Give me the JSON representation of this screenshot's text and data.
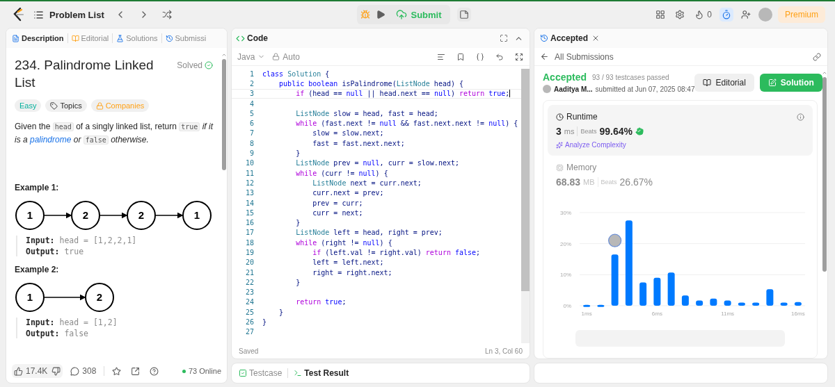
{
  "top_bar": {
    "title": "Problem List",
    "submit": "Submit",
    "streak": "0",
    "timer_active": true,
    "premium": "Premium"
  },
  "description_panel": {
    "tabs": [
      {
        "label": "Description",
        "kind": "description",
        "selected": true
      },
      {
        "label": "Editorial",
        "kind": "editorial",
        "selected": false
      },
      {
        "label": "Solutions",
        "kind": "solutions",
        "selected": false
      },
      {
        "label": "Submissi",
        "kind": "submissions",
        "selected": false
      }
    ],
    "title": "234. Palindrome Linked List",
    "status": "Solved",
    "tags": [
      {
        "label": "Easy",
        "kind": "difficulty"
      },
      {
        "label": "Topics",
        "kind": "topics"
      },
      {
        "label": "Companies",
        "kind": "companies"
      }
    ],
    "statement": [
      {
        "kind": "text",
        "text": "Given the "
      },
      {
        "kind": "code",
        "text": "head"
      },
      {
        "kind": "text",
        "text": " of a singly linked list, return "
      },
      {
        "kind": "code",
        "text": "true"
      },
      {
        "kind": "em",
        "text": " if it is a "
      },
      {
        "kind": "link",
        "text": "palindrome"
      },
      {
        "kind": "em",
        "text": " or "
      },
      {
        "kind": "code",
        "text": "false"
      },
      {
        "kind": "em",
        "text": " otherwise."
      }
    ],
    "examples": [
      {
        "heading": "Example 1:",
        "nodes": [
          "1",
          "2",
          "2",
          "1"
        ],
        "lines": [
          "**Input:** head = [1,2,2,1]",
          "**Output:** true"
        ]
      },
      {
        "heading": "Example 2:",
        "nodes": [
          "1",
          "2"
        ],
        "lines": [
          "**Input:** head = [1,2]",
          "**Output:** false"
        ]
      }
    ],
    "footer": {
      "likes": "17.4K",
      "comments": "308",
      "online": "73 Online"
    }
  },
  "code_panel": {
    "title": "Code",
    "language": "Java",
    "mode": "Auto",
    "lines": [
      {
        "n": "1",
        "tokens": [
          {
            "kind": "keyword",
            "text": "class"
          },
          {
            "kind": "type",
            "text": " Solution"
          },
          {
            "kind": "plain",
            "text": " {"
          }
        ]
      },
      {
        "n": "2",
        "tokens": [
          {
            "kind": "keyword",
            "text": "    public boolean"
          },
          {
            "kind": "plain",
            "text": " isPalindrome("
          },
          {
            "kind": "type",
            "text": "ListNode"
          },
          {
            "kind": "plain",
            "text": " head) {"
          }
        ]
      },
      {
        "n": "3",
        "current": true,
        "tokens": [
          {
            "kind": "control",
            "text": "        if"
          },
          {
            "kind": "plain",
            "text": " (head == "
          },
          {
            "kind": "keyword",
            "text": "null"
          },
          {
            "kind": "plain",
            "text": " || head.next == "
          },
          {
            "kind": "keyword",
            "text": "null"
          },
          {
            "kind": "plain",
            "text": ") "
          },
          {
            "kind": "control",
            "text": "return"
          },
          {
            "kind": "keyword",
            "text": " true"
          },
          {
            "kind": "plain",
            "text": ";"
          }
        ]
      },
      {
        "n": "4"
      },
      {
        "n": "5",
        "tokens": [
          {
            "kind": "type",
            "text": "        ListNode"
          },
          {
            "kind": "plain",
            "text": " slow = head, fast = head;"
          }
        ]
      },
      {
        "n": "6",
        "tokens": [
          {
            "kind": "control",
            "text": "        while"
          },
          {
            "kind": "plain",
            "text": " (fast.next != "
          },
          {
            "kind": "keyword",
            "text": "null"
          },
          {
            "kind": "plain",
            "text": " && fast.next.next != "
          },
          {
            "kind": "keyword",
            "text": "null"
          },
          {
            "kind": "plain",
            "text": ") {"
          }
        ]
      },
      {
        "n": "7",
        "tokens": [
          {
            "kind": "plain",
            "text": "            slow = slow.next;"
          }
        ]
      },
      {
        "n": "8",
        "tokens": [
          {
            "kind": "plain",
            "text": "            fast = fast.next.next;"
          }
        ]
      },
      {
        "n": "9",
        "tokens": [
          {
            "kind": "plain",
            "text": "        }"
          }
        ]
      },
      {
        "n": "10",
        "tokens": [
          {
            "kind": "type",
            "text": "        ListNode"
          },
          {
            "kind": "plain",
            "text": " prev = "
          },
          {
            "kind": "keyword",
            "text": "null"
          },
          {
            "kind": "plain",
            "text": ", curr = slow.next;"
          }
        ]
      },
      {
        "n": "11",
        "tokens": [
          {
            "kind": "control",
            "text": "        while"
          },
          {
            "kind": "plain",
            "text": " (curr != "
          },
          {
            "kind": "keyword",
            "text": "null"
          },
          {
            "kind": "plain",
            "text": ") {"
          }
        ]
      },
      {
        "n": "12",
        "tokens": [
          {
            "kind": "type",
            "text": "            ListNode"
          },
          {
            "kind": "plain",
            "text": " next = curr.next;"
          }
        ]
      },
      {
        "n": "13",
        "tokens": [
          {
            "kind": "plain",
            "text": "            curr.next = prev;"
          }
        ]
      },
      {
        "n": "14",
        "tokens": [
          {
            "kind": "plain",
            "text": "            prev = curr;"
          }
        ]
      },
      {
        "n": "15",
        "tokens": [
          {
            "kind": "plain",
            "text": "            curr = next;"
          }
        ]
      },
      {
        "n": "16",
        "tokens": [
          {
            "kind": "plain",
            "text": "        }"
          }
        ]
      },
      {
        "n": "17",
        "tokens": [
          {
            "kind": "type",
            "text": "        ListNode"
          },
          {
            "kind": "plain",
            "text": " left = head, right = prev;"
          }
        ]
      },
      {
        "n": "18",
        "tokens": [
          {
            "kind": "control",
            "text": "        while"
          },
          {
            "kind": "plain",
            "text": " (right != "
          },
          {
            "kind": "keyword",
            "text": "null"
          },
          {
            "kind": "plain",
            "text": ") {"
          }
        ]
      },
      {
        "n": "19",
        "tokens": [
          {
            "kind": "control",
            "text": "            if"
          },
          {
            "kind": "plain",
            "text": " (left.val != right.val) "
          },
          {
            "kind": "control",
            "text": "return"
          },
          {
            "kind": "keyword",
            "text": " false"
          },
          {
            "kind": "plain",
            "text": ";"
          }
        ]
      },
      {
        "n": "20",
        "tokens": [
          {
            "kind": "plain",
            "text": "            left = left.next;"
          }
        ]
      },
      {
        "n": "21",
        "tokens": [
          {
            "kind": "plain",
            "text": "            right = right.next;"
          }
        ]
      },
      {
        "n": "22",
        "tokens": [
          {
            "kind": "plain",
            "text": "        }"
          }
        ]
      },
      {
        "n": "23"
      },
      {
        "n": "24",
        "tokens": [
          {
            "kind": "control",
            "text": "        return"
          },
          {
            "kind": "keyword",
            "text": " true"
          },
          {
            "kind": "plain",
            "text": ";"
          }
        ]
      },
      {
        "n": "25",
        "tokens": [
          {
            "kind": "plain",
            "text": "    }"
          }
        ]
      },
      {
        "n": "26",
        "tokens": [
          {
            "kind": "plain",
            "text": "}"
          }
        ]
      },
      {
        "n": "27"
      }
    ],
    "status": "Saved",
    "cursor": "Ln 3, Col 60"
  },
  "bottom_tabs": [
    {
      "label": "Testcase",
      "kind": "testcase",
      "selected": false
    },
    {
      "label": "Test Result",
      "kind": "result",
      "selected": true
    }
  ],
  "result_panel": {
    "tab": "Accepted",
    "back": "All Submissions",
    "verdict": "Accepted",
    "testcases": "93 / 93 testcases passed",
    "author": "Aaditya M...",
    "submitted": "submitted at Jun 07, 2025 08:47",
    "buttons": [
      {
        "label": "Editorial",
        "kind": "secondary"
      },
      {
        "label": "Solution",
        "kind": "primary"
      }
    ],
    "metrics": [
      {
        "kind": "runtime",
        "name": "Runtime",
        "value": "3",
        "unit": "ms",
        "beats_label": "Beats",
        "beats": "99.64%",
        "action": "Analyze Complexity",
        "selected": true
      },
      {
        "kind": "memory",
        "name": "Memory",
        "value": "68.83",
        "unit": "MB",
        "beats_label": "Beats",
        "beats": "26.67%",
        "selected": false
      }
    ],
    "chart_data": {
      "type": "bar",
      "x": [
        1,
        2,
        3,
        4,
        5,
        6,
        7,
        8,
        9,
        10,
        11,
        12,
        13,
        14,
        15,
        16
      ],
      "series": [
        {
          "color": "#007aff",
          "values": [
            0.3,
            0.3,
            16.5,
            27.5,
            7.5,
            9,
            10.7,
            3.3,
            1.7,
            2.3,
            1.7,
            1,
            1,
            5.3,
            1,
            1.2
          ]
        }
      ],
      "xlim": [
        0.5,
        16.5
      ],
      "ylim": [
        0,
        30
      ],
      "yticks": [
        {
          "value": 0,
          "label": "0%"
        },
        {
          "value": 10,
          "label": "10%"
        },
        {
          "value": 20,
          "label": "20%"
        },
        {
          "value": 30,
          "label": "30%"
        }
      ],
      "xticks": [
        {
          "value": 1,
          "label": "1ms"
        },
        {
          "value": 6,
          "label": "6ms"
        },
        {
          "value": 11,
          "label": "11ms"
        },
        {
          "value": 16,
          "label": "16ms"
        }
      ]
    }
  }
}
